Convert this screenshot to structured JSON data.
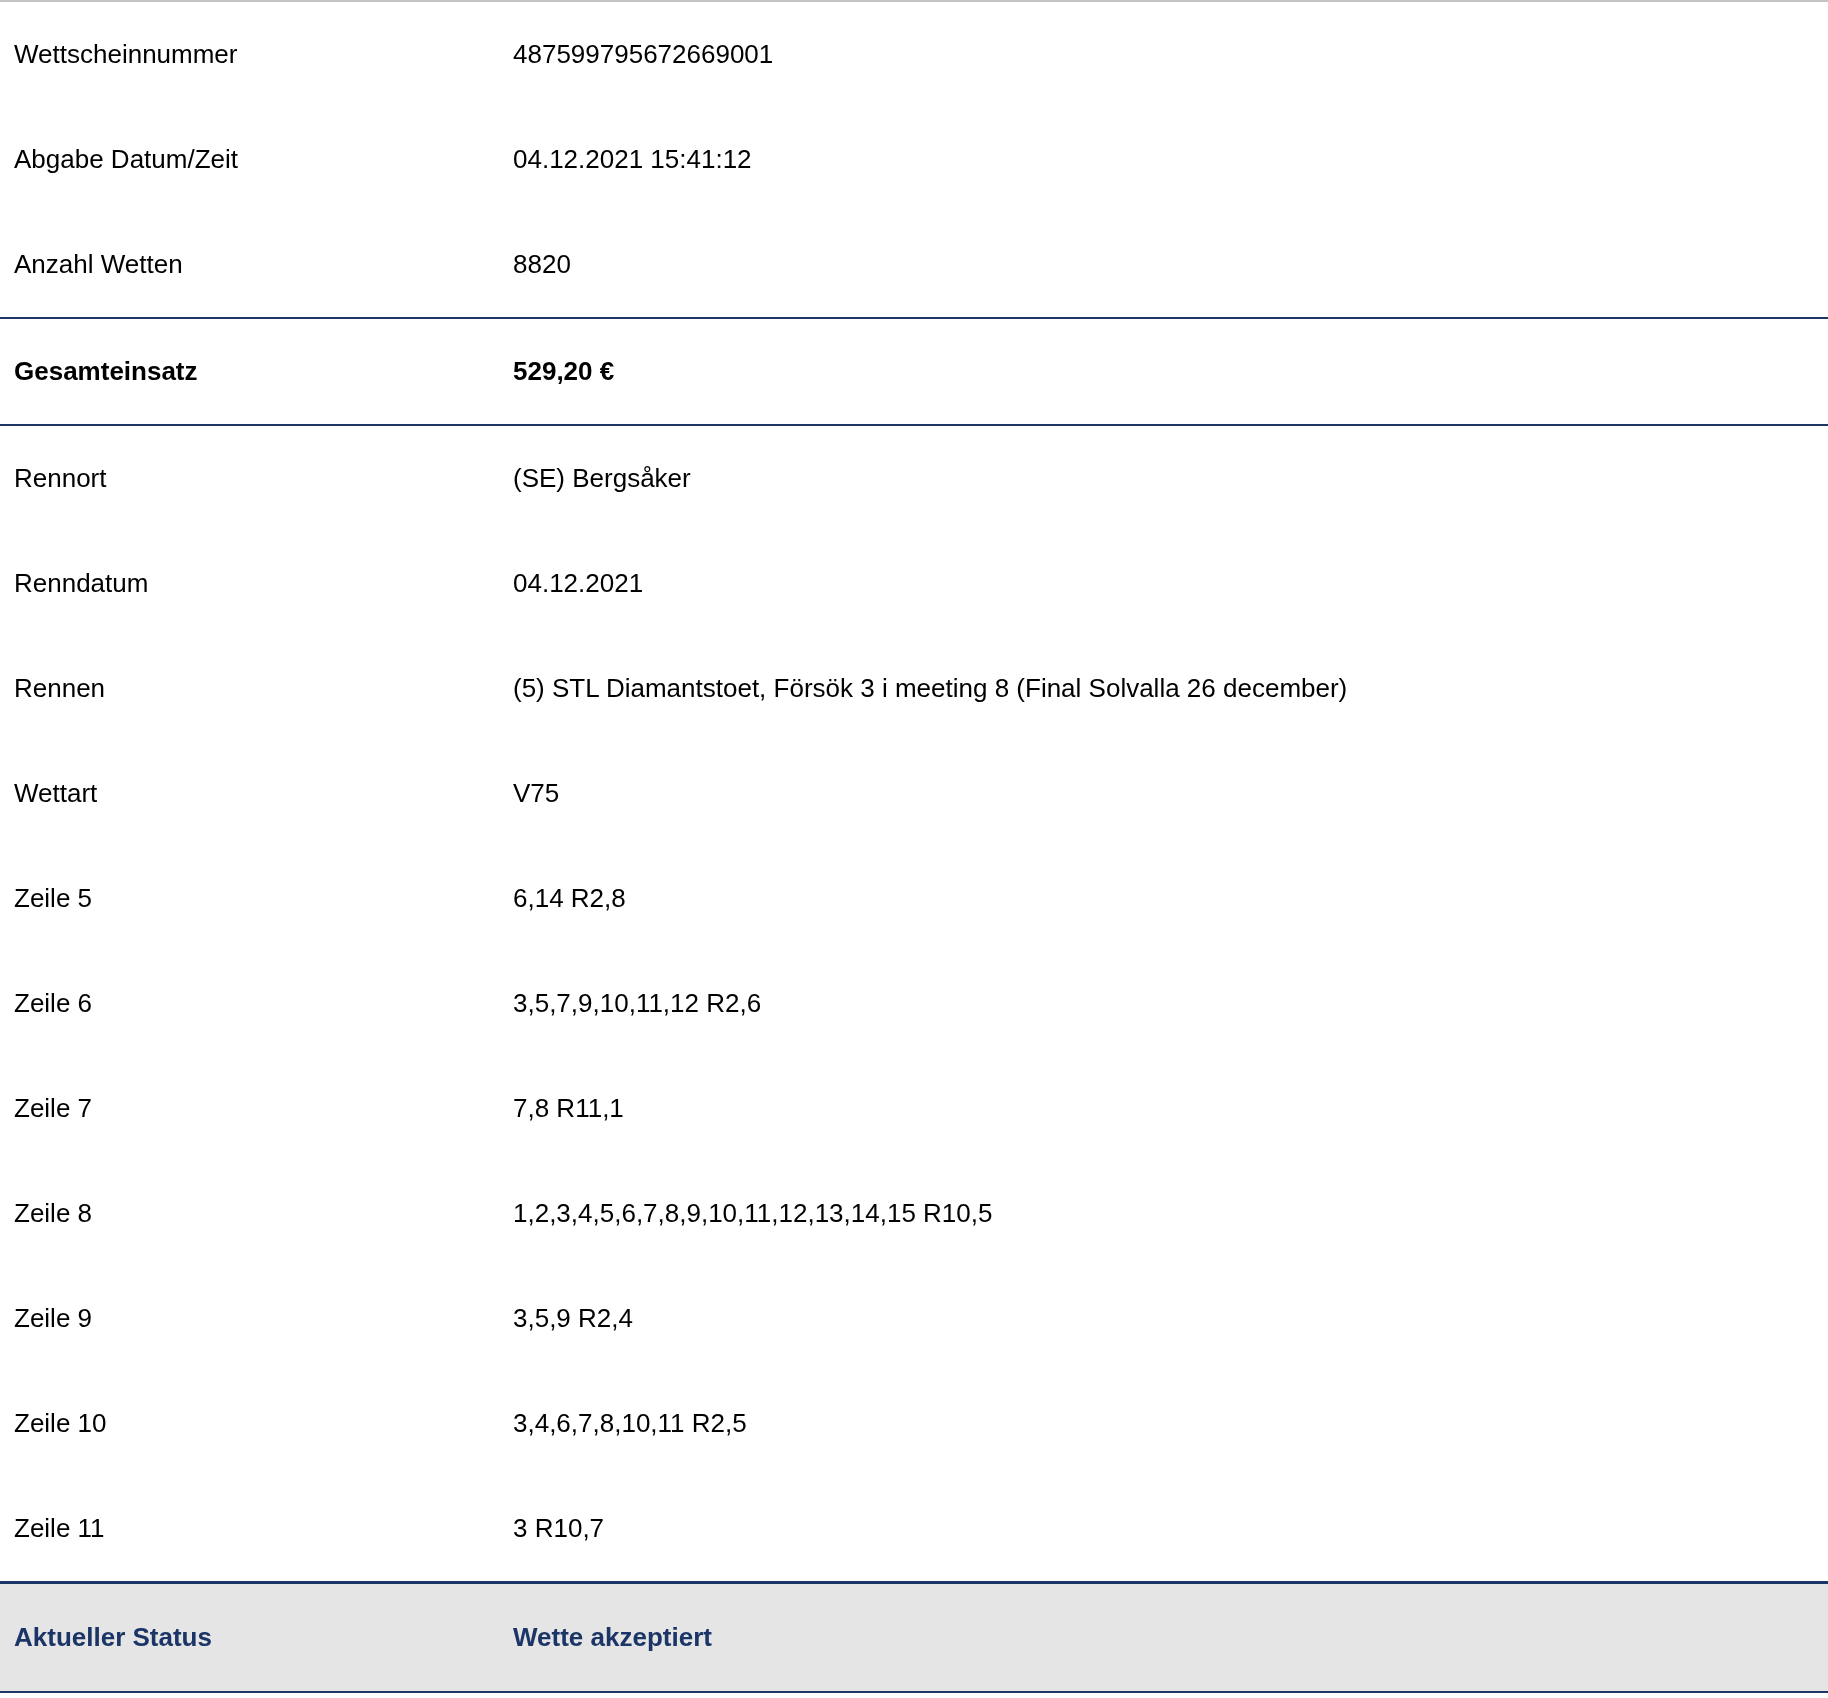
{
  "rows": [
    {
      "kind": "normal",
      "label": "Wettscheinnummer",
      "value": "487599795672669001"
    },
    {
      "kind": "normal",
      "label": "Abgabe Datum/Zeit",
      "value": "04.12.2021 15:41:12"
    },
    {
      "kind": "normal",
      "label": "Anzahl Wetten",
      "value": "8820"
    },
    {
      "kind": "total",
      "label": "Gesamteinsatz",
      "value": "529,20 €"
    },
    {
      "kind": "normal",
      "label": "Rennort",
      "value": "(SE) Bergsåker"
    },
    {
      "kind": "normal",
      "label": "Renndatum",
      "value": "04.12.2021"
    },
    {
      "kind": "normal",
      "label": "Rennen",
      "value": "(5) STL Diamantstoet, Försök 3 i meeting 8 (Final Solvalla 26 december)"
    },
    {
      "kind": "normal",
      "label": "Wettart",
      "value": "V75"
    },
    {
      "kind": "normal",
      "label": "Zeile 5",
      "value": "6,14 R2,8"
    },
    {
      "kind": "normal",
      "label": "Zeile 6",
      "value": "3,5,7,9,10,11,12 R2,6"
    },
    {
      "kind": "normal",
      "label": "Zeile 7",
      "value": "7,8 R11,1"
    },
    {
      "kind": "normal",
      "label": "Zeile 8",
      "value": "1,2,3,4,5,6,7,8,9,10,11,12,13,14,15 R10,5"
    },
    {
      "kind": "normal",
      "label": "Zeile 9",
      "value": "3,5,9 R2,4"
    },
    {
      "kind": "normal",
      "label": "Zeile 10",
      "value": "3,4,6,7,8,10,11 R2,5"
    },
    {
      "kind": "normal",
      "label": "Zeile 11",
      "value": "3 R10,7"
    },
    {
      "kind": "status",
      "label": "Aktueller Status",
      "value": "Wette akzeptiert"
    }
  ]
}
